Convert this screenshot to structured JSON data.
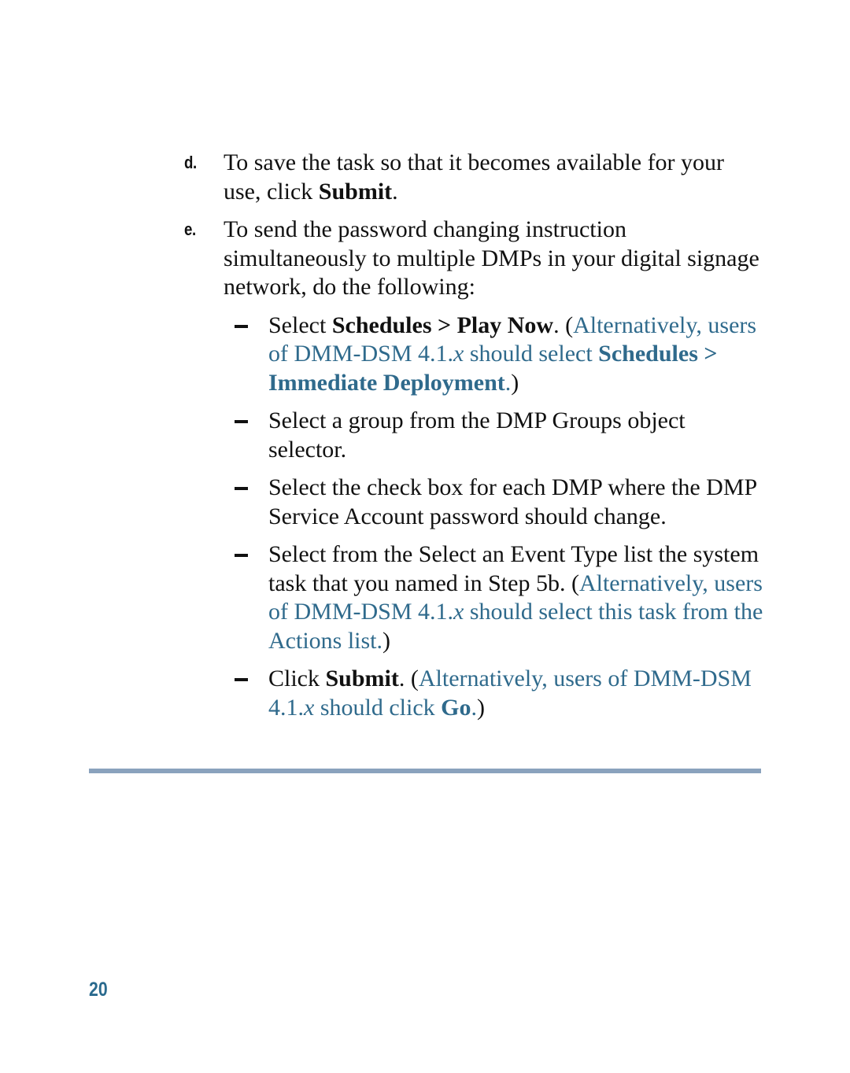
{
  "steps": [
    {
      "marker": "d.",
      "text_before": "To save the task so that it becomes available for your use, click ",
      "bold": "Submit",
      "text_after": "."
    },
    {
      "marker": "e.",
      "text": "To send the password changing instruction simultaneously to multiple DMPs in your digital signage network, do the following:",
      "substeps": [
        {
          "pre": "Select ",
          "bold": "Schedules > Play Now",
          "post": ". ",
          "alt_open": "(",
          "alt_text1": "Alternatively, users of DMM-DSM 4.1.",
          "alt_italic": "x",
          "alt_text2": " should select ",
          "alt_bold": "Schedules > Immediate Deployment",
          "alt_text3": ".",
          "alt_close": ")"
        },
        {
          "text": "Select a group from the DMP Groups object selector."
        },
        {
          "text": "Select the check box for each DMP where the DMP Service Account password should change."
        },
        {
          "text": "Select from the Select an Event Type list the system task that you named in Step 5b. ",
          "alt_open": "(",
          "alt_text1": "Alternatively, users of DMM-DSM 4.1.",
          "alt_italic": "x",
          "alt_text2": " should select this task from the Actions list.",
          "alt_close": ")"
        },
        {
          "pre": "Click ",
          "bold": "Submit",
          "post": ". ",
          "alt_open": "(",
          "alt_text1": "Alternatively, users of DMM-DSM 4.1.",
          "alt_italic": "x",
          "alt_text2": " should click ",
          "alt_bold": "Go",
          "alt_text3": ".",
          "alt_close": ")"
        }
      ]
    }
  ],
  "footer": {
    "page_number": "20"
  },
  "colors": {
    "alternate_text": "#2f6a8c",
    "rule": "#8aa2bd",
    "page_number": "#2a6a8e"
  }
}
